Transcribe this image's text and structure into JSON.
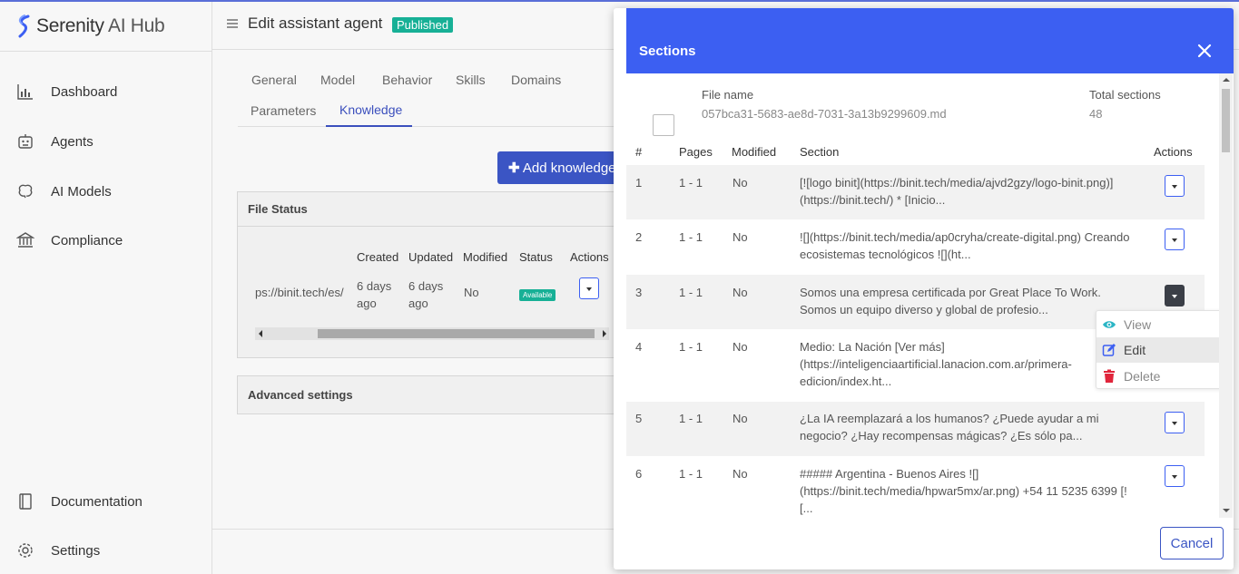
{
  "app": {
    "logo": {
      "name_bold": "Serenity",
      "name_light": " AI Hub"
    },
    "page_title": "Edit assistant agent",
    "status_badge": "Published"
  },
  "sidebar": {
    "items": [
      {
        "label": "Dashboard",
        "icon": "bar-chart-icon"
      },
      {
        "label": "Agents",
        "icon": "robot-icon"
      },
      {
        "label": "AI Models",
        "icon": "brain-icon"
      },
      {
        "label": "Compliance",
        "icon": "bank-icon"
      }
    ],
    "bottom_items": [
      {
        "label": "Documentation",
        "icon": "book-icon"
      },
      {
        "label": "Settings",
        "icon": "gear-icon"
      }
    ]
  },
  "tabs": {
    "row1": [
      "General",
      "Model",
      "Behavior",
      "Skills",
      "Domains"
    ],
    "row2": [
      "Parameters",
      "Knowledge"
    ],
    "active": "Knowledge"
  },
  "knowledge": {
    "add_button": "Add knowledge",
    "file_status": {
      "title": "File Status",
      "columns": [
        "Created",
        "Updated",
        "Modified",
        "Status",
        "Actions"
      ],
      "row": {
        "source": "ps://binit.tech/es/",
        "created": "6 days ago",
        "updated": "6 days ago",
        "modified": "No",
        "status": "Available"
      }
    },
    "advanced_settings": "Advanced settings"
  },
  "modal": {
    "title": "Sections",
    "file_name_label": "File name",
    "file_name": "057bca31-5683-ae8d-7031-3a13b9299609.md",
    "total_sections_label": "Total sections",
    "total_sections": "48",
    "columns": {
      "num": "#",
      "pages": "Pages",
      "modified": "Modified",
      "section": "Section",
      "actions": "Actions"
    },
    "rows": [
      {
        "num": "1",
        "pages": "1 - 1",
        "modified": "No",
        "section": "[![logo binit](https://binit.tech/media/ajvd2gzy/logo-binit.png)](https://binit.tech/) * [Inicio..."
      },
      {
        "num": "2",
        "pages": "1 - 1",
        "modified": "No",
        "section": "![](https://binit.tech/media/ap0cryha/create-digital.png) Creando ecosistemas tecnológicos ![](ht..."
      },
      {
        "num": "3",
        "pages": "1 - 1",
        "modified": "No",
        "section": "Somos una empresa certificada por Great Place To Work. Somos un equipo diverso y global de profesio..."
      },
      {
        "num": "4",
        "pages": "1 - 1",
        "modified": "No",
        "section": "Medio: La Nación [Ver más](https://inteligenciaartificial.lanacion.com.ar/primera-edicion/index.ht..."
      },
      {
        "num": "5",
        "pages": "1 - 1",
        "modified": "No",
        "section": "¿La IA reemplazará a los humanos? ¿Puede ayudar a mi negocio? ¿Hay recompensas mágicas? ¿Es sólo pa..."
      },
      {
        "num": "6",
        "pages": "1 - 1",
        "modified": "No",
        "section": "##### Argentina - Buenos Aires ![](https://binit.tech/media/hpwar5mx/ar.png) +54 11 5235 6399 [![..."
      }
    ],
    "dropdown": [
      {
        "label": "View",
        "icon": "eye-icon"
      },
      {
        "label": "Edit",
        "icon": "edit-icon"
      },
      {
        "label": "Delete",
        "icon": "trash-icon"
      }
    ],
    "cancel": "Cancel"
  },
  "colors": {
    "primary": "#3c5ff2",
    "button_blue": "#3b55c4",
    "success": "#17b096",
    "danger": "#e0253b",
    "eye": "#2bb5c5"
  }
}
